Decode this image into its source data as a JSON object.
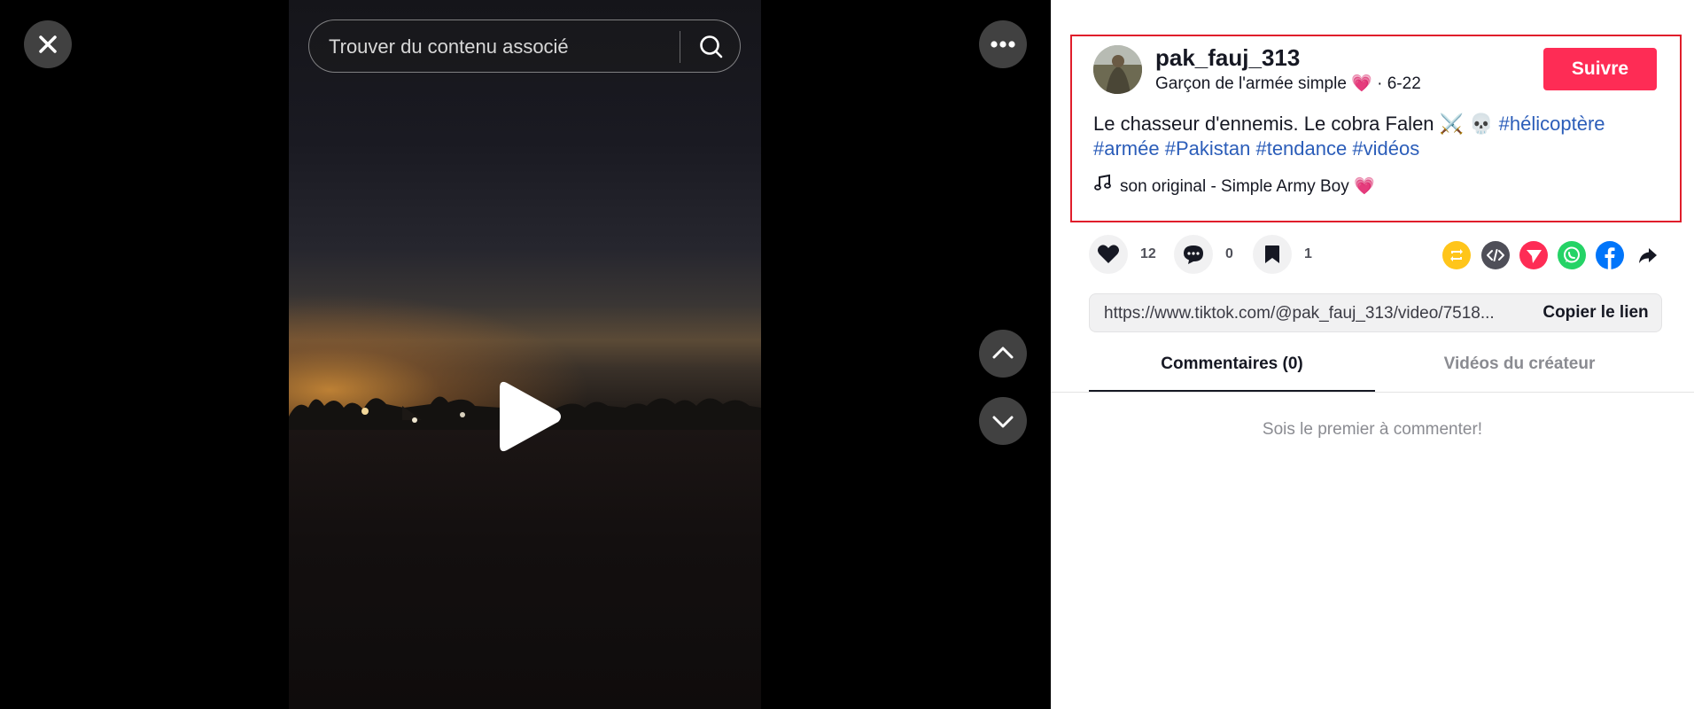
{
  "search": {
    "placeholder": "Trouver du contenu associé"
  },
  "icons": {
    "close": "close-icon",
    "search": "search-icon",
    "more": "more-icon",
    "up": "chevron-up-icon",
    "down": "chevron-down-icon",
    "play": "play-icon"
  },
  "author": {
    "username": "pak_fauj_313",
    "nickname": "Garçon de l'armée simple",
    "nickname_heart": "💗",
    "date": "· 6-22",
    "follow_label": "Suivre"
  },
  "post": {
    "caption": "Le chasseur d'ennemis. Le cobra Falen ⚔️ 💀 ",
    "hashtags": [
      "#hélicoptère",
      "#armée",
      "#Pakistan",
      "#tendance",
      "#vidéos"
    ],
    "music": "son original - Simple Army Boy",
    "music_heart": "💗"
  },
  "stats": {
    "likes": "12",
    "comments": "0",
    "saves": "1"
  },
  "share_targets": [
    "repost",
    "embed",
    "send-to-friends",
    "whatsapp",
    "facebook",
    "share-more"
  ],
  "link": {
    "url": "https://www.tiktok.com/@pak_fauj_313/video/7518...",
    "copy_label": "Copier le lien"
  },
  "tabs": {
    "comments": "Commentaires (0)",
    "creator_videos": "Vidéos du créateur"
  },
  "comments_empty": "Sois le premier à commenter!",
  "colors": {
    "accent": "#fe2c55",
    "hashtag": "#2b5db9",
    "highlight_border": "#e01e2b"
  }
}
